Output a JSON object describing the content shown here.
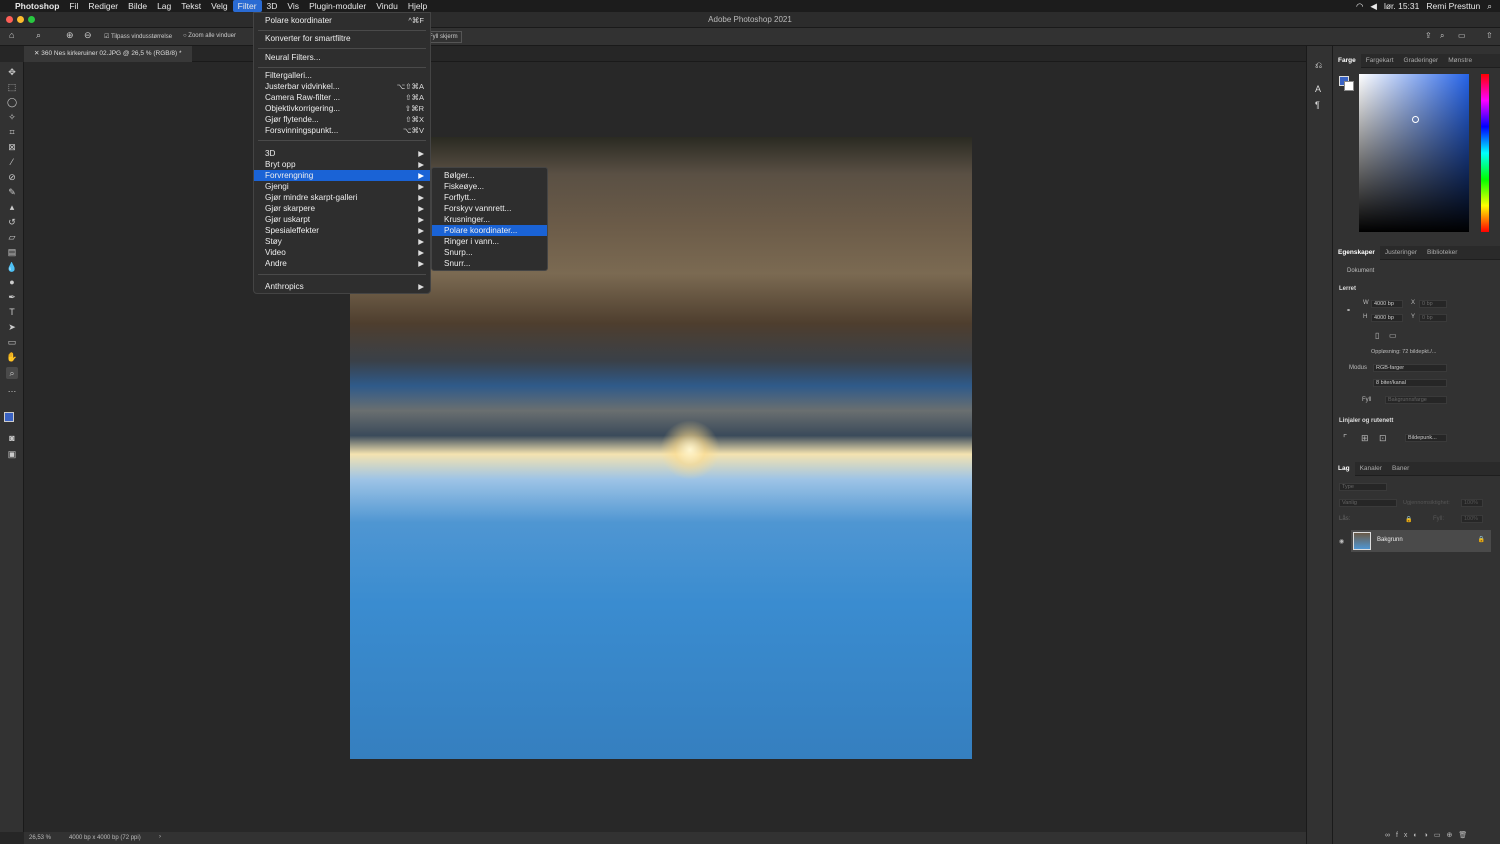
{
  "menubar": {
    "app": "Photoshop",
    "items": [
      "Fil",
      "Rediger",
      "Bilde",
      "Lag",
      "Tekst",
      "Velg",
      "Filter",
      "3D",
      "Vis",
      "Plugin-moduler",
      "Vindu",
      "Hjelp"
    ],
    "active": "Filter",
    "clock": "lør. 15:31",
    "user": "Remi Presttun"
  },
  "window": {
    "title": "Adobe Photoshop 2021"
  },
  "options": {
    "fit_window": "Tilpass vindusstørrelse",
    "zoom_all": "Zoom alle vinduer",
    "fill_screen": "Fyll skjerm"
  },
  "document": {
    "tab": "360 Nes kirkeruiner 02.JPG @ 26,5 % (RGB/8) *",
    "zoom": "26,53 %",
    "size_info": "4000 bp x 4000 bp (72 ppi)"
  },
  "filter_menu": {
    "last_filter": {
      "label": "Polare koordinater",
      "shortcut": "^⌘F"
    },
    "convert_smart": "Konverter for smartfiltre",
    "neural": "Neural Filters...",
    "group1": [
      {
        "label": "Filtergalleri...",
        "shortcut": ""
      },
      {
        "label": "Justerbar vidvinkel...",
        "shortcut": "⌥⇧⌘A"
      },
      {
        "label": "Camera Raw-filter ...",
        "shortcut": "⇧⌘A"
      },
      {
        "label": "Objektivkorrigering...",
        "shortcut": "⇧⌘R"
      },
      {
        "label": "Gjør flytende...",
        "shortcut": "⇧⌘X"
      },
      {
        "label": "Forsvinningspunkt...",
        "shortcut": "⌥⌘V"
      }
    ],
    "group2": [
      "3D",
      "Bryt opp",
      "Forvrengning",
      "Gjengi",
      "Gjør mindre skarpt-galleri",
      "Gjør skarpere",
      "Gjør uskarpt",
      "Spesialeffekter",
      "Støy",
      "Video",
      "Andre"
    ],
    "highlighted": "Forvrengning",
    "anthropics": "Anthropics"
  },
  "distort_submenu": {
    "items": [
      "Bølger...",
      "Fiskeøye...",
      "Forflytt...",
      "Forskyv vannrett...",
      "Krusninger...",
      "Polare koordinater...",
      "Ringer i vann...",
      "Snurp...",
      "Snurr..."
    ],
    "highlighted": "Polare koordinater..."
  },
  "color_panel": {
    "tabs": [
      "Farge",
      "Fargekart",
      "Graderinger",
      "Mønstre"
    ]
  },
  "properties_panel": {
    "tabs": [
      "Egenskaper",
      "Justeringer",
      "Biblioteker"
    ],
    "doc_label": "Dokument",
    "canvas_section": "Lerret",
    "w_label": "W",
    "w_value": "4000 bp",
    "h_label": "H",
    "h_value": "4000 bp",
    "x_label": "X",
    "x_value": "0 bp",
    "y_label": "Y",
    "y_value": "0 bp",
    "resolution": "Oppløsning: 72 bildepkt./...",
    "mode_label": "Modus",
    "mode_value": "RGB-farger",
    "depth_value": "8 biter/kanal",
    "fill_label": "Fyll",
    "fill_value": "Bakgrunnsfarge",
    "rulers_section": "Linjaler og rutenett",
    "guides_value": "Bildepunk..."
  },
  "layers_panel": {
    "tabs": [
      "Lag",
      "Kanaler",
      "Baner"
    ],
    "search": "Type",
    "blend": "Vanlig",
    "opacity_label": "Ugjennomsiktighet:",
    "opacity_value": "100%",
    "lock_label": "Lås:",
    "fill_label": "Fyll:",
    "fill_value": "100%",
    "layer_name": "Bakgrunn"
  },
  "colors": {
    "accent": "#1a63d6",
    "fg_swatch": "#3a63c4",
    "bg_swatch": "#ffffff"
  }
}
